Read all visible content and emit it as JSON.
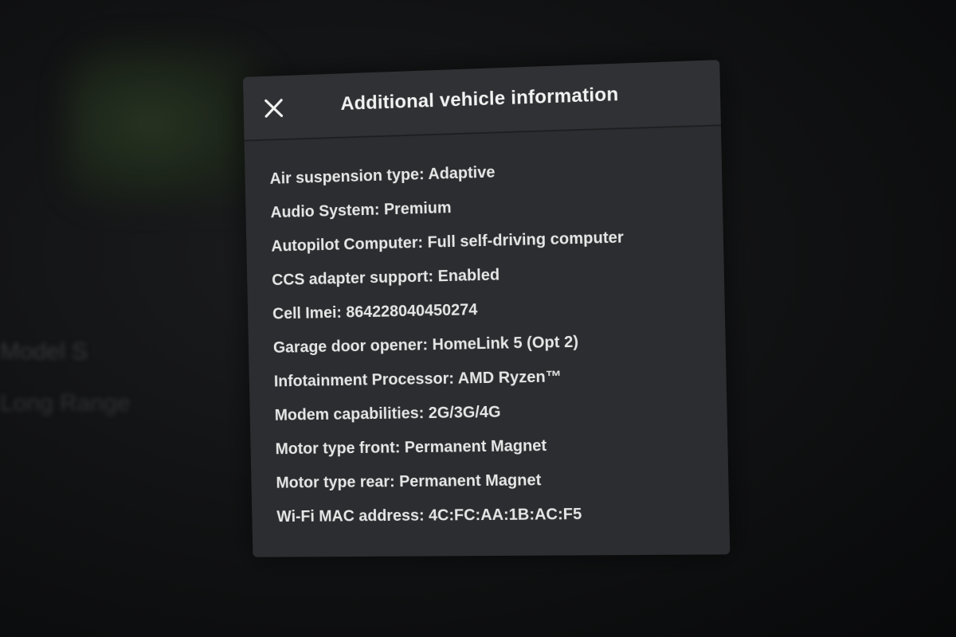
{
  "background": {
    "model": "Model S",
    "trim": "Long Range"
  },
  "modal": {
    "title": "Additional vehicle information",
    "close_icon": "close-icon",
    "items": [
      {
        "label": "Air suspension type",
        "value": "Adaptive"
      },
      {
        "label": "Audio System",
        "value": "Premium"
      },
      {
        "label": "Autopilot Computer",
        "value": "Full self-driving computer"
      },
      {
        "label": "CCS adapter support",
        "value": "Enabled"
      },
      {
        "label": "Cell Imei",
        "value": "864228040450274"
      },
      {
        "label": "Garage door opener",
        "value": "HomeLink 5 (Opt 2)"
      },
      {
        "label": "Infotainment Processor",
        "value": "AMD Ryzen™"
      },
      {
        "label": "Modem capabilities",
        "value": "2G/3G/4G"
      },
      {
        "label": "Motor type front",
        "value": "Permanent Magnet"
      },
      {
        "label": "Motor type rear",
        "value": "Permanent Magnet"
      },
      {
        "label": "Wi-Fi MAC address",
        "value": "4C:FC:AA:1B:AC:F5"
      }
    ]
  },
  "colors": {
    "modal_bg": "#2c2d30",
    "header_bg": "#303134",
    "text": "#e6e6e6",
    "title": "#f2f2f2"
  }
}
